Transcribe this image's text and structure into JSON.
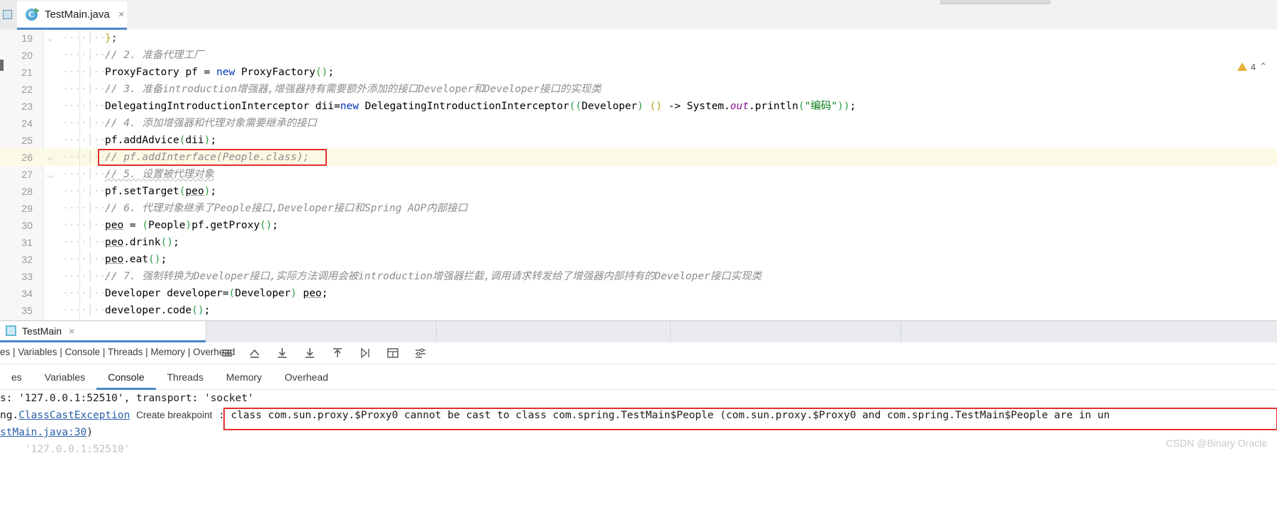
{
  "window": {
    "tab": {
      "title": "TestMain.java",
      "icon": "java-class-icon",
      "close": "×"
    }
  },
  "editor": {
    "warning": {
      "count": "4",
      "icon": "warning-triangle-icon",
      "chevron": "⌃"
    },
    "lines": [
      {
        "num": "19",
        "fold": "⌵",
        "indent": "····│····",
        "segments": [
          {
            "t": "}",
            "c": "pyellow"
          },
          {
            "t": ";",
            "c": "par"
          }
        ]
      },
      {
        "num": "20",
        "fold": "",
        "indent": "····│····",
        "segments": [
          {
            "t": "// 2. 准备代理工厂",
            "c": "cm"
          }
        ]
      },
      {
        "num": "21",
        "fold": "",
        "indent": "····│····",
        "segments": [
          {
            "t": "ProxyFactory pf = ",
            "c": ""
          },
          {
            "t": "new",
            "c": "k"
          },
          {
            "t": " ProxyFactory",
            "c": ""
          },
          {
            "t": "()",
            "c": "pgreen"
          },
          {
            "t": ";",
            "c": ""
          }
        ]
      },
      {
        "num": "22",
        "fold": "",
        "indent": "····│····",
        "segments": [
          {
            "t": "// 3. 准备introduction增强器,增强器持有需要额外添加的接口Developer和Developer接口的实现类",
            "c": "cm"
          }
        ]
      },
      {
        "num": "23",
        "fold": "",
        "indent": "····│···",
        "segments": [
          {
            "t": "DelegatingIntroductionInterceptor dii=",
            "c": ""
          },
          {
            "t": "new",
            "c": "k"
          },
          {
            "t": " DelegatingIntroductionInterceptor",
            "c": ""
          },
          {
            "t": "((",
            "c": "pgreen"
          },
          {
            "t": "Developer",
            "c": ""
          },
          {
            "t": ") ",
            "c": "pgreen"
          },
          {
            "t": "()",
            "c": "pyellow"
          },
          {
            "t": " -> System.",
            "c": ""
          },
          {
            "t": "out",
            "c": "fld"
          },
          {
            "t": ".println",
            "c": ""
          },
          {
            "t": "(",
            "c": "pgreen"
          },
          {
            "t": "\"编码\"",
            "c": "str"
          },
          {
            "t": "))",
            "c": "pgreen"
          },
          {
            "t": ";",
            "c": ""
          }
        ]
      },
      {
        "num": "24",
        "fold": "",
        "indent": "····│····",
        "segments": [
          {
            "t": "// 4. 添加增强器和代理对象需要继承的接口",
            "c": "cm"
          }
        ]
      },
      {
        "num": "25",
        "fold": "",
        "indent": "····│····",
        "segments": [
          {
            "t": "pf.addAdvice",
            "c": ""
          },
          {
            "t": "(",
            "c": "pgreen"
          },
          {
            "t": "dii",
            "c": ""
          },
          {
            "t": ")",
            "c": "pgreen"
          },
          {
            "t": ";",
            "c": ""
          }
        ]
      },
      {
        "num": "26",
        "fold": "⌵",
        "indent": "····│····",
        "current": true,
        "boxed": true,
        "segments": [
          {
            "t": "// pf.addInterface(People.class);",
            "c": "cm"
          }
        ]
      },
      {
        "num": "27",
        "fold": "⌴",
        "indent": "····│····",
        "segments": [
          {
            "t": "// 5. 设置被代理对象",
            "c": "cm-u"
          }
        ]
      },
      {
        "num": "28",
        "fold": "",
        "indent": "····│····",
        "segments": [
          {
            "t": "pf.setTarget",
            "c": ""
          },
          {
            "t": "(",
            "c": "pgreen"
          },
          {
            "t": "peo",
            "c": "var-u"
          },
          {
            "t": ")",
            "c": "pgreen"
          },
          {
            "t": ";",
            "c": ""
          }
        ]
      },
      {
        "num": "29",
        "fold": "",
        "indent": "····│····",
        "segments": [
          {
            "t": "// 6. 代理对象继承了People接口,Developer接口和Spring AOP内部接口",
            "c": "cm"
          }
        ]
      },
      {
        "num": "30",
        "fold": "",
        "indent": "····│····",
        "segments": [
          {
            "t": "peo",
            "c": "var-u"
          },
          {
            "t": " = ",
            "c": ""
          },
          {
            "t": "(",
            "c": "pgreen"
          },
          {
            "t": "People",
            "c": ""
          },
          {
            "t": ")",
            "c": "pgreen"
          },
          {
            "t": "pf.getProxy",
            "c": ""
          },
          {
            "t": "()",
            "c": "pgreen"
          },
          {
            "t": ";",
            "c": ""
          }
        ]
      },
      {
        "num": "31",
        "fold": "",
        "indent": "····│····",
        "segments": [
          {
            "t": "peo",
            "c": "var-u"
          },
          {
            "t": ".drink",
            "c": ""
          },
          {
            "t": "()",
            "c": "pgreen"
          },
          {
            "t": ";",
            "c": ""
          }
        ]
      },
      {
        "num": "32",
        "fold": "",
        "indent": "····│····",
        "segments": [
          {
            "t": "peo",
            "c": "var-u"
          },
          {
            "t": ".eat",
            "c": ""
          },
          {
            "t": "()",
            "c": "pgreen"
          },
          {
            "t": ";",
            "c": ""
          }
        ]
      },
      {
        "num": "33",
        "fold": "",
        "indent": "····│····",
        "segments": [
          {
            "t": "// 7. 强制转换为Developer接口,实际方法调用会被introduction增强器拦截,调用请求转发给了增强器内部持有的Developer接口实现类",
            "c": "cm"
          }
        ]
      },
      {
        "num": "34",
        "fold": "",
        "indent": "····│····",
        "segments": [
          {
            "t": "Developer developer=",
            "c": ""
          },
          {
            "t": "(",
            "c": "pgreen"
          },
          {
            "t": "Developer",
            "c": ""
          },
          {
            "t": ") ",
            "c": "pgreen"
          },
          {
            "t": "peo",
            "c": "var-u"
          },
          {
            "t": ";",
            "c": ""
          }
        ]
      },
      {
        "num": "35",
        "fold": "",
        "indent": "····│····",
        "segments": [
          {
            "t": "developer.code",
            "c": ""
          },
          {
            "t": "()",
            "c": "pgreen"
          },
          {
            "t": ";",
            "c": ""
          }
        ]
      }
    ]
  },
  "bottom_panel": {
    "run_tab": {
      "title": "TestMain",
      "icon": "run-console-icon",
      "close": "×"
    },
    "debugger_tabs_compact": "es | Variables | Console | Threads | Memory | Overhead",
    "toolbar_icons": [
      "layout-icon",
      "step-out-icon",
      "step-into-icon",
      "force-step-into-icon",
      "step-up-icon",
      "run-to-cursor-icon",
      "evaluate-icon",
      "settings-icon"
    ],
    "content_tabs": [
      {
        "label": "es",
        "active": false
      },
      {
        "label": "Variables",
        "active": false
      },
      {
        "label": "Console",
        "active": true
      },
      {
        "label": "Threads",
        "active": false
      },
      {
        "label": "Memory",
        "active": false
      },
      {
        "label": "Overhead",
        "active": false
      }
    ],
    "console_lines": [
      {
        "id": "line-transport",
        "segments": [
          {
            "t": "s: '127.0.0.1:52510', transport: 'socket'",
            "c": ""
          }
        ]
      },
      {
        "id": "line-exception",
        "segments": [
          {
            "t": "ng.",
            "c": ""
          },
          {
            "t": "ClassCastException",
            "c": "clink"
          },
          {
            "t": " ",
            "c": ""
          },
          {
            "t": "Create breakpoint",
            "c": "bpoint"
          },
          {
            "t": " : class com.sun.proxy.$Proxy0 cannot be cast to class com.spring.TestMain$People (com.sun.proxy.$Proxy0 and com.spring.TestMain$People",
            "c": ""
          },
          {
            "t": " are in un",
            "c": ""
          }
        ]
      },
      {
        "id": "line-stack",
        "segments": [
          {
            "t": "stMain.java:30",
            "c": "clink"
          },
          {
            "t": ")",
            "c": ""
          }
        ]
      },
      {
        "id": "line-faded",
        "segments": [
          {
            "t": "    '127.0.0.1:52510'",
            "c": "cfade"
          }
        ]
      }
    ],
    "watermark": "CSDN @Binary Oracle"
  }
}
